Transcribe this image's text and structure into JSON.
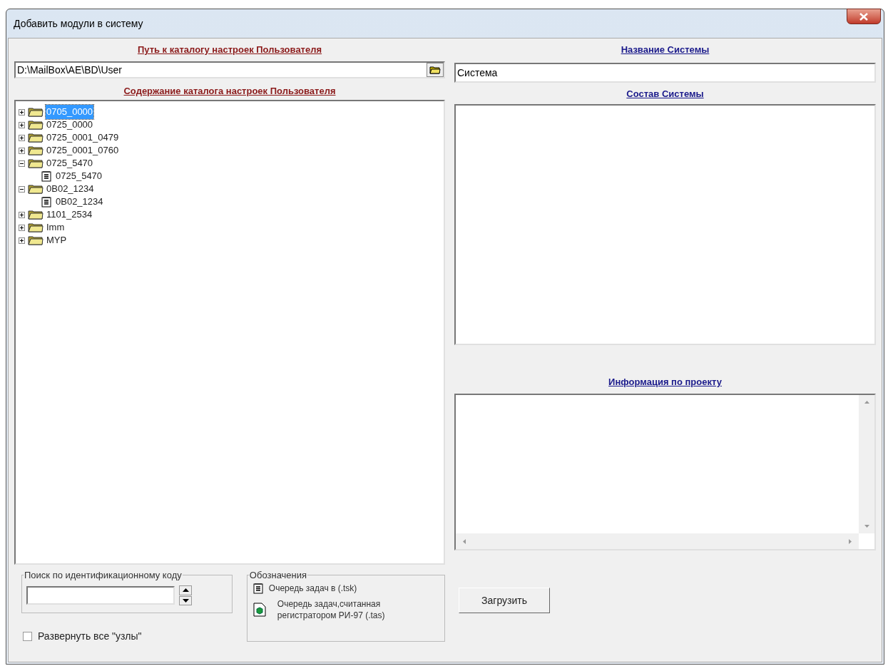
{
  "window": {
    "title": "Добавить модули в систему"
  },
  "left": {
    "path_heading": "Путь к каталогу настроек Пользователя",
    "path_value": "D:\\MailBox\\AE\\BD\\User",
    "tree_heading": "Содержание каталога настроек Пользователя",
    "tree": [
      {
        "label": "0705_0000",
        "kind": "folder",
        "expanded": false,
        "selected": true
      },
      {
        "label": "0725_0000",
        "kind": "folder",
        "expanded": false,
        "selected": false
      },
      {
        "label": "0725_0001_0479",
        "kind": "folder",
        "expanded": false,
        "selected": false
      },
      {
        "label": "0725_0001_0760",
        "kind": "folder",
        "expanded": false,
        "selected": false
      },
      {
        "label": "0725_5470",
        "kind": "folder",
        "expanded": true,
        "selected": false,
        "children": [
          {
            "label": "0725_5470",
            "kind": "task",
            "selected": false
          }
        ]
      },
      {
        "label": "0B02_1234",
        "kind": "folder",
        "expanded": true,
        "selected": false,
        "children": [
          {
            "label": "0B02_1234",
            "kind": "task",
            "selected": false
          }
        ]
      },
      {
        "label": "1101_2534",
        "kind": "folder",
        "expanded": false,
        "selected": false
      },
      {
        "label": "Imm",
        "kind": "folder",
        "expanded": false,
        "selected": false
      },
      {
        "label": "MYP",
        "kind": "folder",
        "expanded": false,
        "selected": false
      }
    ],
    "search": {
      "legend": "Поиск по идентификационному коду"
    },
    "expand_all": {
      "label": "Развернуть все \"узлы\"",
      "checked": false
    },
    "legend": {
      "title": "Обозначения",
      "items": [
        {
          "kind": "task",
          "text": "Очередь задач в (.tsk)"
        },
        {
          "kind": "registered",
          "text": "Очередь задач,считанная регистратором РИ-97 (.tas)"
        }
      ]
    }
  },
  "right": {
    "name_heading": "Название Системы",
    "name_value": "Система",
    "composition_heading": "Состав Системы",
    "info_heading": "Информация по проекту",
    "load_button": "Загрузить"
  }
}
